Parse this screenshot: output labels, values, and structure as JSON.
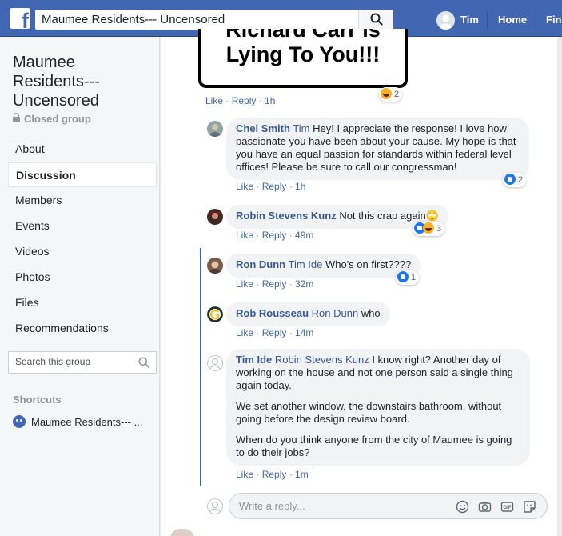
{
  "topbar": {
    "search_value": "Maumee Residents--- Uncensored",
    "user_name": "Tim",
    "home_label": "Home",
    "find_label": "Find",
    "brand_color": "#4267b2"
  },
  "sidebar": {
    "group_title": "Maumee Residents--- Uncensored",
    "privacy": "Closed group",
    "nav": [
      {
        "label": "About"
      },
      {
        "label": "Discussion"
      },
      {
        "label": "Members"
      },
      {
        "label": "Events"
      },
      {
        "label": "Videos"
      },
      {
        "label": "Photos"
      },
      {
        "label": "Files"
      },
      {
        "label": "Recommendations"
      }
    ],
    "search_placeholder": "Search this group",
    "shortcuts_heading": "Shortcuts",
    "shortcut_item": "Maumee Residents--- ..."
  },
  "poster": {
    "line1": "Richard Carr is",
    "line2": "Lying To You!!!"
  },
  "top_comment": {
    "like": "Like",
    "reply": "Reply",
    "time": "1h",
    "reactions": {
      "icons": [
        "haha-icon"
      ],
      "count": "2"
    }
  },
  "comments": [
    {
      "author": "Chel Smith",
      "tag": "Tim",
      "paragraphs": [
        "Hey! I appreciate the response! I love how passionate you have been about your cause. My hope is that you have an equal passion for standards within federal level offices! Please be sure to call our congressman!"
      ],
      "like": "Like",
      "reply": "Reply",
      "time": "1h",
      "reactions": {
        "icons": [
          "like-icon"
        ],
        "count": "2"
      }
    },
    {
      "author": "Robin Stevens Kunz",
      "tag": "",
      "paragraphs": [
        "Not this crap again🙄"
      ],
      "like": "Like",
      "reply": "Reply",
      "time": "49m",
      "reactions": {
        "icons": [
          "like-icon",
          "haha-icon"
        ],
        "count": "3"
      }
    },
    {
      "author": "Ron Dunn",
      "tag": "Tim Ide",
      "paragraphs": [
        "Who's on first????"
      ],
      "like": "Like",
      "reply": "Reply",
      "time": "32m",
      "reactions": {
        "icons": [
          "like-icon"
        ],
        "count": "1"
      }
    },
    {
      "author": "Rob Rousseau",
      "tag": "Ron Dunn",
      "paragraphs": [
        "who"
      ],
      "like": "Like",
      "reply": "Reply",
      "time": "14m",
      "reactions": null
    },
    {
      "author": "Tim Ide",
      "tag": "Robin Stevens Kunz",
      "paragraphs": [
        "I know right? Another day of working on the house and not one person said a single thing again today.",
        "We set another window, the downstairs bathroom, without going before the design review board.",
        "When do you think anyone from the city of Maumee is going to do their jobs?"
      ],
      "like": "Like",
      "reply": "Reply",
      "time": "1m",
      "reactions": null
    }
  ],
  "reply_box": {
    "placeholder": "Write a reply..."
  }
}
